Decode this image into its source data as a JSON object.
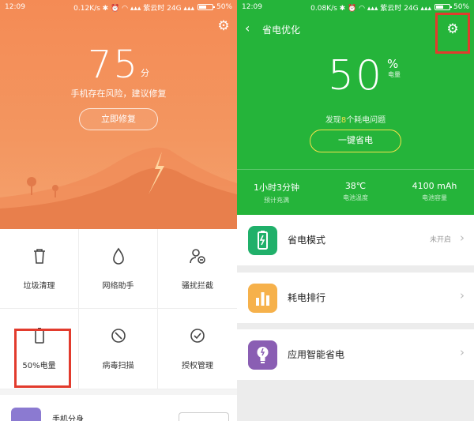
{
  "left": {
    "status": {
      "time": "12:09",
      "right": "0.12K/s ✱ ⏰ ◠ ▴▴▴ 紫云时 24G ▴▴▴",
      "battery": "50%"
    },
    "score": "75",
    "score_unit": "分",
    "score_desc": "手机存在风险，建议修复",
    "fix_button": "立即修复",
    "tools": [
      {
        "label": "垃圾清理",
        "icon": "trash-icon"
      },
      {
        "label": "网络助手",
        "icon": "water-drop-icon"
      },
      {
        "label": "骚扰拦截",
        "icon": "user-block-icon"
      },
      {
        "label": "50%电量",
        "icon": "battery-icon"
      },
      {
        "label": "病毒扫描",
        "icon": "scan-icon"
      },
      {
        "label": "授权管理",
        "icon": "check-circle-icon"
      }
    ],
    "bottom_card_title": "手机分身"
  },
  "right": {
    "status": {
      "time": "12:09",
      "right": "0.08K/s ✱ ⏰ ◠ ▴▴▴ 紫云时 24G ▴▴▴",
      "battery": "50%"
    },
    "nav_title": "省电优化",
    "percent": "50",
    "percent_sign": "%",
    "percent_label": "电量",
    "found_pre": "发现",
    "found_num": "8",
    "found_post": "个耗电问题",
    "optimize_button": "一键省电",
    "stats": [
      {
        "value": "1小时3分钟",
        "label": "预计充满"
      },
      {
        "value": "38℃",
        "label": "电池温度"
      },
      {
        "value": "4100 mAh",
        "label": "电池容量"
      }
    ],
    "rows": [
      {
        "label": "省电模式",
        "status": "未开启",
        "icon": "battery-charging-icon",
        "color": "#20b06a"
      },
      {
        "label": "耗电排行",
        "status": "",
        "icon": "bar-chart-icon",
        "color": "#f6b14b"
      },
      {
        "label": "应用智能省电",
        "status": "",
        "icon": "lightbulb-icon",
        "color": "#8a5eb3"
      }
    ]
  },
  "colors": {
    "orange": "#f48b55",
    "green": "#25b43a",
    "highlight": "#e23b2d"
  }
}
